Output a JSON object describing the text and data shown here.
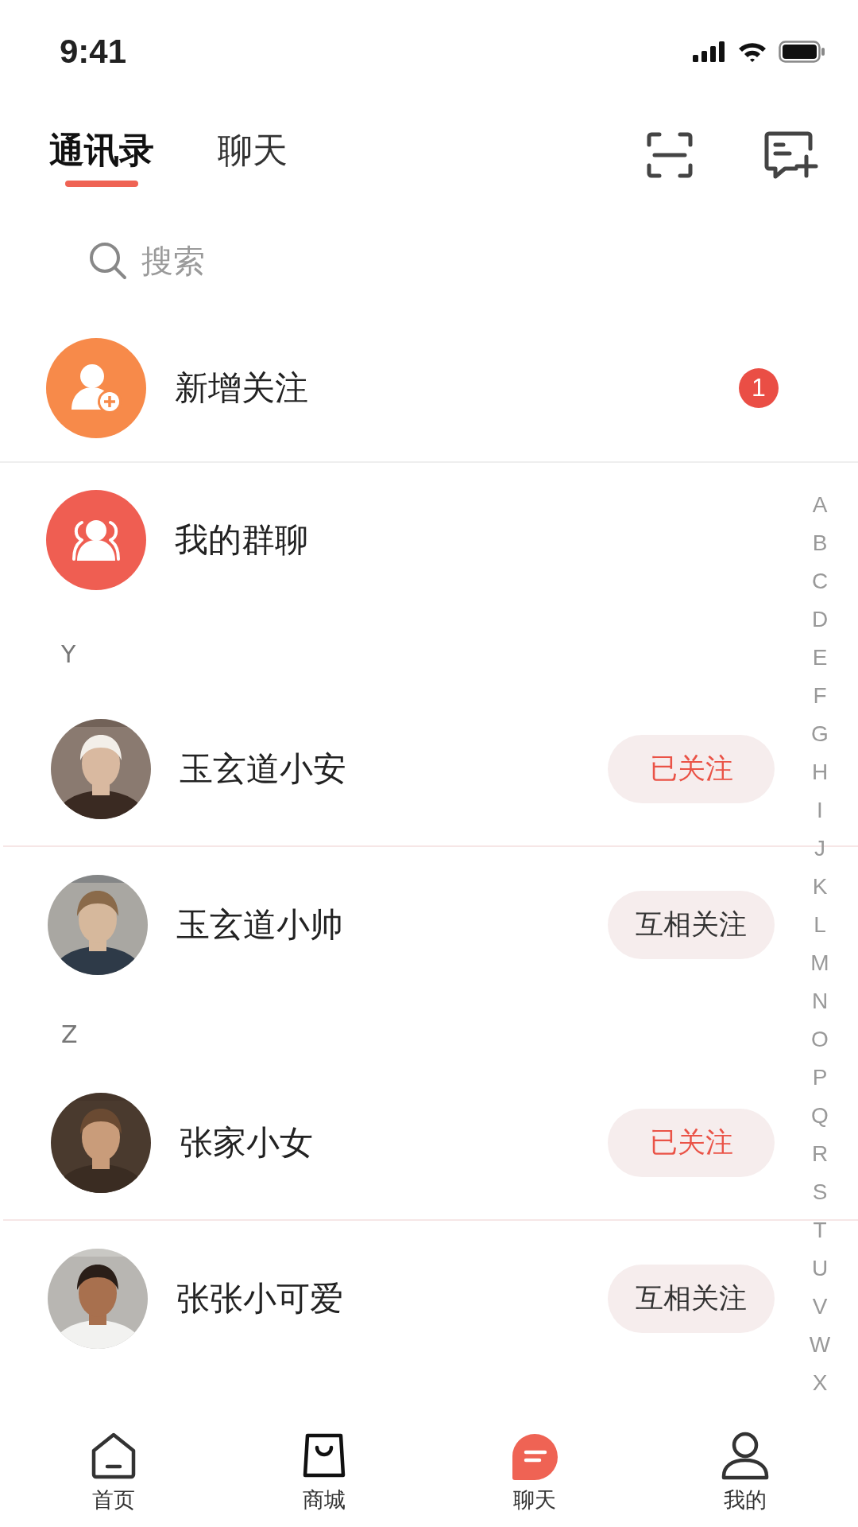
{
  "status_bar": {
    "time": "9:41"
  },
  "tabs": [
    {
      "label": "通讯录",
      "selected": true
    },
    {
      "label": "聊天",
      "selected": false
    }
  ],
  "search": {
    "placeholder": "搜索"
  },
  "entries": [
    {
      "kind": "new-follow",
      "label": "新增关注",
      "badge": "1"
    },
    {
      "kind": "groups",
      "label": "我的群聊"
    }
  ],
  "sections": [
    {
      "letter": "Y",
      "contacts": [
        {
          "name": "玉玄道小安",
          "status": "已关注",
          "kind": "followed"
        },
        {
          "name": "玉玄道小帅",
          "status": "互相关注",
          "kind": "mutual"
        }
      ]
    },
    {
      "letter": "Z",
      "contacts": [
        {
          "name": "张家小女",
          "status": "已关注",
          "kind": "followed"
        },
        {
          "name": "张张小可爱",
          "status": "互相关注",
          "kind": "mutual"
        }
      ]
    }
  ],
  "index_letters": [
    "A",
    "B",
    "C",
    "D",
    "E",
    "F",
    "G",
    "H",
    "I",
    "J",
    "K",
    "L",
    "M",
    "N",
    "O",
    "P",
    "Q",
    "R",
    "S",
    "T",
    "U",
    "V",
    "W",
    "X"
  ],
  "bottom_nav": [
    {
      "kind": "home",
      "label": "首页",
      "selected": false
    },
    {
      "kind": "shop",
      "label": "商城",
      "selected": false
    },
    {
      "kind": "chat",
      "label": "聊天",
      "selected": true
    },
    {
      "kind": "profile",
      "label": "我的",
      "selected": false
    }
  ]
}
